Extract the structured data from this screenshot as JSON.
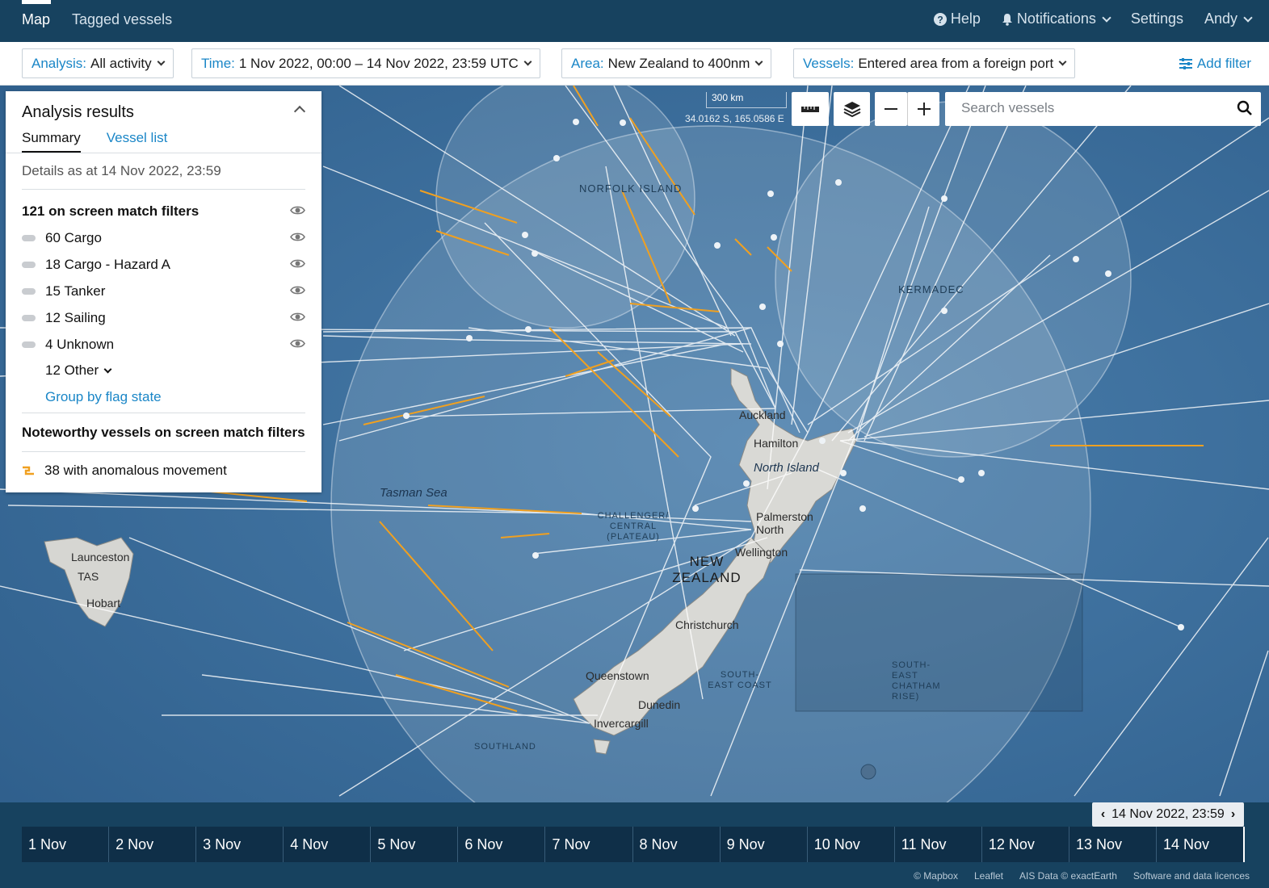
{
  "nav": {
    "tabs": [
      {
        "label": "Map"
      },
      {
        "label": "Tagged vessels"
      }
    ],
    "help": "Help",
    "notifications": "Notifications",
    "settings": "Settings",
    "user": "Andy"
  },
  "filters": {
    "analysis": {
      "key": "Analysis:",
      "value": "All activity"
    },
    "time": {
      "key": "Time:",
      "value": "1 Nov 2022, 00:00 – 14 Nov 2022, 23:59 UTC"
    },
    "area": {
      "key": "Area:",
      "value": "New Zealand to 400nm"
    },
    "vessels": {
      "key": "Vessels:",
      "value": "Entered area from a foreign port"
    },
    "add_filter": "Add filter"
  },
  "panel": {
    "title": "Analysis results",
    "tabs": [
      "Summary",
      "Vessel list"
    ],
    "as_at": "Details as at 14 Nov 2022, 23:59",
    "total": "121 on screen match filters",
    "categories": [
      {
        "label": "60 Cargo"
      },
      {
        "label": "18 Cargo - Hazard A"
      },
      {
        "label": "15 Tanker"
      },
      {
        "label": "12 Sailing"
      },
      {
        "label": "4 Unknown"
      }
    ],
    "other": "12 Other",
    "group_by": "Group by flag state",
    "noteworthy_title": "Noteworthy vessels on screen match filters",
    "anomalous": "38 with anomalous movement",
    "anomaly_color": "#f0a020"
  },
  "map": {
    "scale": "300 km",
    "coords": "34.0162 S, 165.0586 E",
    "search_placeholder": "Search vessels",
    "track_color": "#ffffff",
    "anomaly_track_color": "#f0a020",
    "labels": {
      "norfolk": "NORFOLK ISLAND",
      "kermadec": "KERMADEC",
      "tasman": "Tasman Sea",
      "north_island": "North Island",
      "nz": "NEW ZEALAND",
      "auckland": "Auckland",
      "hamilton": "Hamilton",
      "palmerston": "Palmerston North",
      "wellington": "Wellington",
      "christchurch": "Christchurch",
      "queenstown": "Queenstown",
      "dunedin": "Dunedin",
      "invercargill": "Invercargill",
      "launceston": "Launceston",
      "tas": "TAS",
      "hobart": "Hobart",
      "challenger": "CHALLENGER/ CENTRAL (PLATEAU)",
      "southland": "SOUTHLAND",
      "se_coast": "SOUTH-EAST COAST",
      "chatham": "SOUTH-EAST CHATHAM RISE)"
    }
  },
  "timeline": {
    "current": "14 Nov 2022, 23:59",
    "days": [
      "1 Nov",
      "2 Nov",
      "3 Nov",
      "4 Nov",
      "5 Nov",
      "6 Nov",
      "7 Nov",
      "8 Nov",
      "9 Nov",
      "10 Nov",
      "11 Nov",
      "12 Nov",
      "13 Nov",
      "14 Nov"
    ]
  },
  "footer": [
    "© Mapbox",
    "Leaflet",
    "AIS Data © exactEarth",
    "Software and data licences"
  ]
}
